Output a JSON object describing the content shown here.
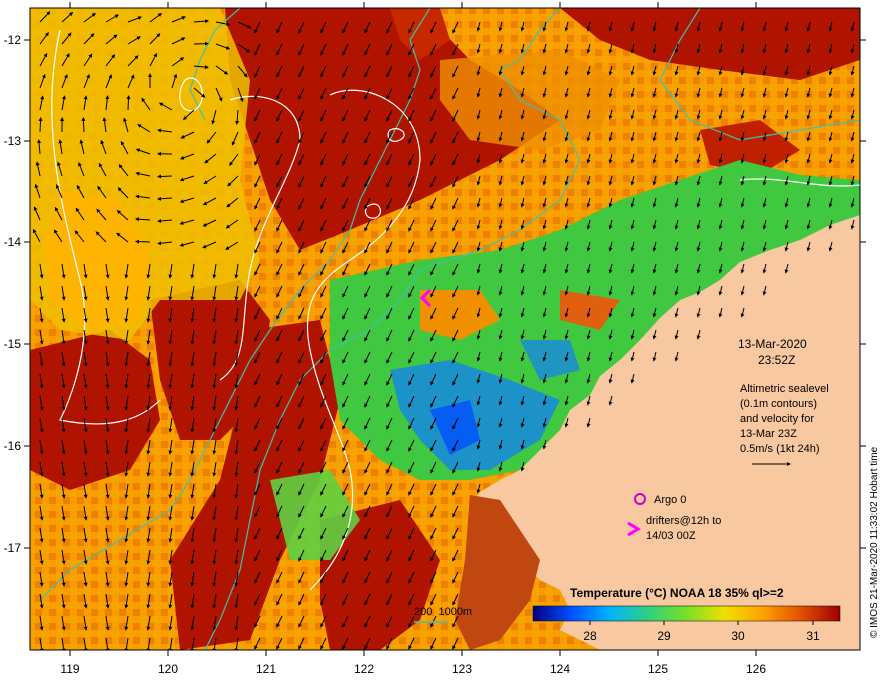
{
  "map": {
    "x_ticks": [
      "119",
      "120",
      "121",
      "122",
      "123",
      "124",
      "125",
      "126"
    ],
    "y_ticks": [
      "-12",
      "-13",
      "-14",
      "-15",
      "-16",
      "-17"
    ]
  },
  "info": {
    "date": "13-Mar-2020",
    "time": "23:52Z",
    "altimetry": [
      "Altimetric sealevel",
      "(0.1m contours)",
      "and velocity for",
      "13-Mar 23Z"
    ],
    "velocity_scale": "0.5m/s (1kt 24h)"
  },
  "legend": {
    "argo": "Argo 0",
    "drifters": [
      "drifters@12h to",
      "14/03 00Z"
    ],
    "bathymetry": "200  1000m"
  },
  "colorbar": {
    "title": "Temperature (°C) NOAA 18 35% ql>=2",
    "ticks": [
      "28",
      "29",
      "30",
      "31"
    ],
    "colors": [
      "#000080",
      "#0050ff",
      "#00b4ff",
      "#30d080",
      "#78e028",
      "#f0e000",
      "#ffa000",
      "#e05000",
      "#a00000"
    ]
  },
  "credit": "© IMOS 21-Mar-2020 11:33:02 Hobart time",
  "colors": {
    "land": "#f8c8a0",
    "warm": "#ff9a00",
    "hot": "#b01400",
    "mid": "#f0c000",
    "cool": "#40c840",
    "cold": "#1888e0",
    "contour": "#ffffff",
    "bathy": "#40c0b0"
  }
}
